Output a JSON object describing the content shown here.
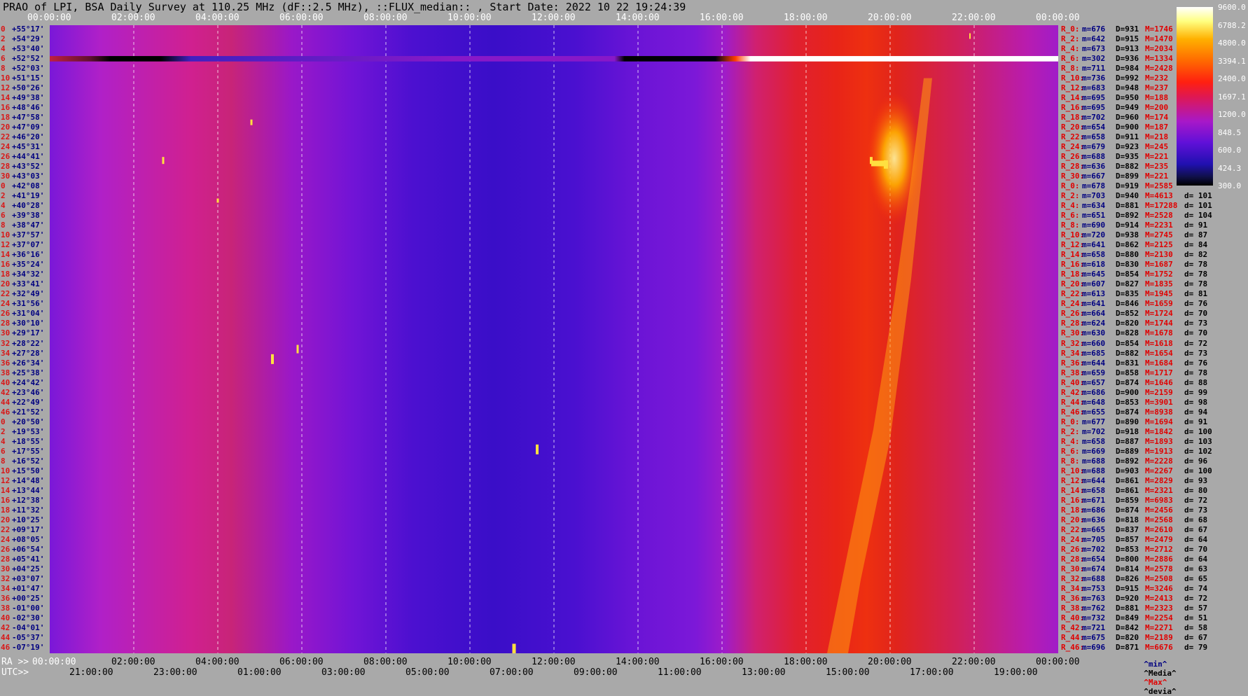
{
  "title": "PRAO of LPI, BSA Daily Survey at 110.25 MHz (dF::2.5 MHz), ::FLUX_median:: , Start Date: 2022 10 22 19:24:39",
  "axes": {
    "ra_label": "RA >>",
    "utc_label": "UTC>>",
    "top_ticks": [
      "00:00:00",
      "02:00:00",
      "04:00:00",
      "06:00:00",
      "08:00:00",
      "10:00:00",
      "12:00:00",
      "14:00:00",
      "16:00:00",
      "18:00:00",
      "20:00:00",
      "22:00:00",
      "00:00:00"
    ],
    "bottom_ra_ticks": [
      "00:00:00",
      "02:00:00",
      "04:00:00",
      "06:00:00",
      "08:00:00",
      "10:00:00",
      "12:00:00",
      "14:00:00",
      "16:00:00",
      "18:00:00",
      "20:00:00",
      "22:00:00",
      "00:00:00"
    ],
    "bottom_utc_ticks": [
      "21:00:00",
      "23:00:00",
      "01:00:00",
      "03:00:00",
      "05:00:00",
      "07:00:00",
      "09:00:00",
      "11:00:00",
      "13:00:00",
      "15:00:00",
      "17:00:00",
      "19:00:00"
    ]
  },
  "declinations": [
    {
      "idx": "0",
      "dec": "+55°17'"
    },
    {
      "idx": "2",
      "dec": "+54°29'"
    },
    {
      "idx": "4",
      "dec": "+53°40'"
    },
    {
      "idx": "6",
      "dec": "+52°52'"
    },
    {
      "idx": "8",
      "dec": "+52°03'"
    },
    {
      "idx": "10",
      "dec": "+51°15'"
    },
    {
      "idx": "12",
      "dec": "+50°26'"
    },
    {
      "idx": "14",
      "dec": "+49°38'"
    },
    {
      "idx": "16",
      "dec": "+48°46'"
    },
    {
      "idx": "18",
      "dec": "+47°58'"
    },
    {
      "idx": "20",
      "dec": "+47°09'"
    },
    {
      "idx": "22",
      "dec": "+46°20'"
    },
    {
      "idx": "24",
      "dec": "+45°31'"
    },
    {
      "idx": "26",
      "dec": "+44°41'"
    },
    {
      "idx": "28",
      "dec": "+43°52'"
    },
    {
      "idx": "30",
      "dec": "+43°03'"
    },
    {
      "idx": "0",
      "dec": "+42°08'"
    },
    {
      "idx": "2",
      "dec": "+41°19'"
    },
    {
      "idx": "4",
      "dec": "+40°28'"
    },
    {
      "idx": "6",
      "dec": "+39°38'"
    },
    {
      "idx": "8",
      "dec": "+38°47'"
    },
    {
      "idx": "10",
      "dec": "+37°57'"
    },
    {
      "idx": "12",
      "dec": "+37°07'"
    },
    {
      "idx": "14",
      "dec": "+36°16'"
    },
    {
      "idx": "16",
      "dec": "+35°24'"
    },
    {
      "idx": "18",
      "dec": "+34°32'"
    },
    {
      "idx": "20",
      "dec": "+33°41'"
    },
    {
      "idx": "22",
      "dec": "+32°49'"
    },
    {
      "idx": "24",
      "dec": "+31°56'"
    },
    {
      "idx": "26",
      "dec": "+31°04'"
    },
    {
      "idx": "28",
      "dec": "+30°10'"
    },
    {
      "idx": "30",
      "dec": "+29°17'"
    },
    {
      "idx": "32",
      "dec": "+28°22'"
    },
    {
      "idx": "34",
      "dec": "+27°28'"
    },
    {
      "idx": "36",
      "dec": "+26°34'"
    },
    {
      "idx": "38",
      "dec": "+25°38'"
    },
    {
      "idx": "40",
      "dec": "+24°42'"
    },
    {
      "idx": "42",
      "dec": "+23°46'"
    },
    {
      "idx": "44",
      "dec": "+22°49'"
    },
    {
      "idx": "46",
      "dec": "+21°52'"
    },
    {
      "idx": "0",
      "dec": "+20°50'"
    },
    {
      "idx": "2",
      "dec": "+19°53'"
    },
    {
      "idx": "4",
      "dec": "+18°55'"
    },
    {
      "idx": "6",
      "dec": "+17°55'"
    },
    {
      "idx": "8",
      "dec": "+16°52'"
    },
    {
      "idx": "10",
      "dec": "+15°50'"
    },
    {
      "idx": "12",
      "dec": "+14°48'"
    },
    {
      "idx": "14",
      "dec": "+13°44'"
    },
    {
      "idx": "16",
      "dec": "+12°38'"
    },
    {
      "idx": "18",
      "dec": "+11°32'"
    },
    {
      "idx": "20",
      "dec": "+10°25'"
    },
    {
      "idx": "22",
      "dec": "+09°17'"
    },
    {
      "idx": "24",
      "dec": "+08°05'"
    },
    {
      "idx": "26",
      "dec": "+06°54'"
    },
    {
      "idx": "28",
      "dec": "+05°41'"
    },
    {
      "idx": "30",
      "dec": "+04°25'"
    },
    {
      "idx": "32",
      "dec": "+03°07'"
    },
    {
      "idx": "34",
      "dec": "+01°47'"
    },
    {
      "idx": "36",
      "dec": "+00°25'"
    },
    {
      "idx": "38",
      "dec": "-01°00'"
    },
    {
      "idx": "40",
      "dec": "-02°30'"
    },
    {
      "idx": "42",
      "dec": "-04°01'"
    },
    {
      "idx": "44",
      "dec": "-05°37'"
    },
    {
      "idx": "46",
      "dec": "-07°19'"
    }
  ],
  "colorbar": {
    "ticks": [
      "9600.0",
      "6788.2",
      "4800.0",
      "3394.1",
      "2400.0",
      "1697.1",
      "1200.0",
      "848.5",
      "600.0",
      "424.3",
      "300.0"
    ],
    "colors": [
      "#000000",
      "#2010b0",
      "#6010d8",
      "#a818c8",
      "#e01850",
      "#ff2010",
      "#ff6a00",
      "#ffb000",
      "#ffff80",
      "#ffffff"
    ]
  },
  "stats": [
    {
      "r": "R_0:",
      "m": "m=676",
      "D": "D=931",
      "M": "M=1746",
      "d": ""
    },
    {
      "r": "R_2:",
      "m": "m=642",
      "D": "D=915",
      "M": "M=1470",
      "d": ""
    },
    {
      "r": "R_4:",
      "m": "m=673",
      "D": "D=913",
      "M": "M=2034",
      "d": ""
    },
    {
      "r": "R_6:",
      "m": "m=302",
      "D": "D=936",
      "M": "M=1334",
      "d": ""
    },
    {
      "r": "R_8:",
      "m": "m=711",
      "D": "D=984",
      "M": "M=2428",
      "d": ""
    },
    {
      "r": "R_10:",
      "m": "m=736",
      "D": "D=992",
      "M": "M=232",
      "d": ""
    },
    {
      "r": "R_12:",
      "m": "m=683",
      "D": "D=948",
      "M": "M=237",
      "d": ""
    },
    {
      "r": "R_14:",
      "m": "m=695",
      "D": "D=950",
      "M": "M=188",
      "d": ""
    },
    {
      "r": "R_16:",
      "m": "m=695",
      "D": "D=949",
      "M": "M=200",
      "d": ""
    },
    {
      "r": "R_18:",
      "m": "m=702",
      "D": "D=960",
      "M": "M=174",
      "d": ""
    },
    {
      "r": "R_20:",
      "m": "m=654",
      "D": "D=900",
      "M": "M=187",
      "d": ""
    },
    {
      "r": "R_22:",
      "m": "m=658",
      "D": "D=911",
      "M": "M=218",
      "d": ""
    },
    {
      "r": "R_24:",
      "m": "m=679",
      "D": "D=923",
      "M": "M=245",
      "d": ""
    },
    {
      "r": "R_26:",
      "m": "m=688",
      "D": "D=935",
      "M": "M=221",
      "d": ""
    },
    {
      "r": "R_28:",
      "m": "m=636",
      "D": "D=882",
      "M": "M=235",
      "d": ""
    },
    {
      "r": "R_30:",
      "m": "m=667",
      "D": "D=899",
      "M": "M=221",
      "d": ""
    },
    {
      "r": "R_0:",
      "m": "m=678",
      "D": "D=919",
      "M": "M=2585",
      "d": ""
    },
    {
      "r": "R_2:",
      "m": "m=703",
      "D": "D=940",
      "M": "M=4613",
      "d": "d= 101"
    },
    {
      "r": "R_4:",
      "m": "m=634",
      "D": "D=881",
      "M": "M=17288",
      "d": "d= 101"
    },
    {
      "r": "R_6:",
      "m": "m=651",
      "D": "D=892",
      "M": "M=2528",
      "d": "d= 104"
    },
    {
      "r": "R_8:",
      "m": "m=690",
      "D": "D=914",
      "M": "M=2231",
      "d": "d= 91"
    },
    {
      "r": "R_10:",
      "m": "m=720",
      "D": "D=938",
      "M": "M=2745",
      "d": "d= 87"
    },
    {
      "r": "R_12:",
      "m": "m=641",
      "D": "D=862",
      "M": "M=2125",
      "d": "d= 84"
    },
    {
      "r": "R_14:",
      "m": "m=658",
      "D": "D=880",
      "M": "M=2130",
      "d": "d= 82"
    },
    {
      "r": "R_16:",
      "m": "m=618",
      "D": "D=830",
      "M": "M=1687",
      "d": "d= 78"
    },
    {
      "r": "R_18:",
      "m": "m=645",
      "D": "D=854",
      "M": "M=1752",
      "d": "d= 78"
    },
    {
      "r": "R_20:",
      "m": "m=607",
      "D": "D=827",
      "M": "M=1835",
      "d": "d= 78"
    },
    {
      "r": "R_22:",
      "m": "m=613",
      "D": "D=835",
      "M": "M=1945",
      "d": "d= 81"
    },
    {
      "r": "R_24:",
      "m": "m=641",
      "D": "D=846",
      "M": "M=1659",
      "d": "d= 76"
    },
    {
      "r": "R_26:",
      "m": "m=664",
      "D": "D=852",
      "M": "M=1724",
      "d": "d= 70"
    },
    {
      "r": "R_28:",
      "m": "m=624",
      "D": "D=820",
      "M": "M=1744",
      "d": "d= 73"
    },
    {
      "r": "R_30:",
      "m": "m=630",
      "D": "D=828",
      "M": "M=1678",
      "d": "d= 70"
    },
    {
      "r": "R_32:",
      "m": "m=660",
      "D": "D=854",
      "M": "M=1618",
      "d": "d= 72"
    },
    {
      "r": "R_34:",
      "m": "m=685",
      "D": "D=882",
      "M": "M=1654",
      "d": "d= 73"
    },
    {
      "r": "R_36:",
      "m": "m=644",
      "D": "D=831",
      "M": "M=1684",
      "d": "d= 76"
    },
    {
      "r": "R_38:",
      "m": "m=659",
      "D": "D=858",
      "M": "M=1717",
      "d": "d= 78"
    },
    {
      "r": "R_40:",
      "m": "m=657",
      "D": "D=874",
      "M": "M=1646",
      "d": "d= 88"
    },
    {
      "r": "R_42:",
      "m": "m=686",
      "D": "D=900",
      "M": "M=2159",
      "d": "d= 99"
    },
    {
      "r": "R_44:",
      "m": "m=648",
      "D": "D=853",
      "M": "M=3901",
      "d": "d= 98"
    },
    {
      "r": "R_46:",
      "m": "m=655",
      "D": "D=874",
      "M": "M=8938",
      "d": "d= 94"
    },
    {
      "r": "R_0:",
      "m": "m=677",
      "D": "D=890",
      "M": "M=1694",
      "d": "d= 91"
    },
    {
      "r": "R_2:",
      "m": "m=702",
      "D": "D=918",
      "M": "M=1842",
      "d": "d= 100"
    },
    {
      "r": "R_4:",
      "m": "m=658",
      "D": "D=887",
      "M": "M=1893",
      "d": "d= 103"
    },
    {
      "r": "R_6:",
      "m": "m=669",
      "D": "D=889",
      "M": "M=1913",
      "d": "d= 102"
    },
    {
      "r": "R_8:",
      "m": "m=688",
      "D": "D=892",
      "M": "M=2228",
      "d": "d= 96"
    },
    {
      "r": "R_10:",
      "m": "m=688",
      "D": "D=903",
      "M": "M=2267",
      "d": "d= 100"
    },
    {
      "r": "R_12:",
      "m": "m=644",
      "D": "D=861",
      "M": "M=2829",
      "d": "d= 93"
    },
    {
      "r": "R_14:",
      "m": "m=658",
      "D": "D=861",
      "M": "M=2321",
      "d": "d= 80"
    },
    {
      "r": "R_16:",
      "m": "m=671",
      "D": "D=859",
      "M": "M=6983",
      "d": "d= 72"
    },
    {
      "r": "R_18:",
      "m": "m=686",
      "D": "D=874",
      "M": "M=2456",
      "d": "d= 73"
    },
    {
      "r": "R_20:",
      "m": "m=636",
      "D": "D=818",
      "M": "M=2568",
      "d": "d= 68"
    },
    {
      "r": "R_22:",
      "m": "m=665",
      "D": "D=837",
      "M": "M=2610",
      "d": "d= 67"
    },
    {
      "r": "R_24:",
      "m": "m=705",
      "D": "D=857",
      "M": "M=2479",
      "d": "d= 64"
    },
    {
      "r": "R_26:",
      "m": "m=702",
      "D": "D=853",
      "M": "M=2712",
      "d": "d= 70"
    },
    {
      "r": "R_28:",
      "m": "m=654",
      "D": "D=800",
      "M": "M=2886",
      "d": "d= 64"
    },
    {
      "r": "R_30:",
      "m": "m=674",
      "D": "D=814",
      "M": "M=2578",
      "d": "d= 63"
    },
    {
      "r": "R_32:",
      "m": "m=688",
      "D": "D=826",
      "M": "M=2508",
      "d": "d= 65"
    },
    {
      "r": "R_34:",
      "m": "m=753",
      "D": "D=915",
      "M": "M=3246",
      "d": "d= 74"
    },
    {
      "r": "R_36:",
      "m": "m=763",
      "D": "D=920",
      "M": "M=2413",
      "d": "d= 72"
    },
    {
      "r": "R_38:",
      "m": "m=762",
      "D": "D=881",
      "M": "M=2323",
      "d": "d= 57"
    },
    {
      "r": "R_40:",
      "m": "m=732",
      "D": "D=849",
      "M": "M=2254",
      "d": "d= 51"
    },
    {
      "r": "R_42:",
      "m": "m=721",
      "D": "D=842",
      "M": "M=2271",
      "d": "d= 58"
    },
    {
      "r": "R_44:",
      "m": "m=675",
      "D": "D=820",
      "M": "M=2189",
      "d": "d= 67"
    },
    {
      "r": "R_46:",
      "m": "m=696",
      "D": "D=871",
      "M": "M=6676",
      "d": "d= 79"
    }
  ],
  "legend": {
    "min": "^min^",
    "median": "^Media^",
    "max": "^Max^",
    "devia": "^devia^"
  },
  "chart_data": {
    "type": "heatmap",
    "title": "PRAO of LPI, BSA Daily Survey at 110.25 MHz (dF::2.5 MHz), ::FLUX_median:: , Start Date: 2022 10 22 19:24:39",
    "x_axis": "RA (hours), 00:00:00 to 24:00:00",
    "y_axis": "Declination, +55°17' to -07°19'",
    "colorscale_range": [
      300.0,
      9600.0
    ],
    "colorscale_ticks": [
      9600.0,
      6788.2,
      4800.0,
      3394.1,
      2400.0,
      1697.1,
      1200.0,
      848.5,
      600.0,
      424.3,
      300.0
    ],
    "grid": true,
    "features": [
      {
        "ra_hours": [
          0,
          24
        ],
        "dec_row": 3,
        "note": "saturated horizontal streak; black near RA 2h and 14h, white from RA 16.5h to 24h"
      },
      {
        "ra_hours": [
          19.8,
          20.5
        ],
        "dec_range": [
          48,
          38
        ],
        "peak": 17288
      },
      {
        "ra_hours": [
          18.5,
          20.2
        ],
        "dec_range": [
          20,
          -7
        ],
        "peak": 6983
      },
      {
        "ra_hours": [
          5.2,
          5.6
        ],
        "dec_deg": 22.0,
        "peak": 8938
      },
      {
        "ra_hours": [
          11.5,
          11.6
        ],
        "dec_deg": 13.0,
        "peak": 6983
      },
      {
        "ra_hours": [
          11.0,
          11.2
        ],
        "dec_deg": -7.0,
        "peak": 6676
      }
    ]
  }
}
